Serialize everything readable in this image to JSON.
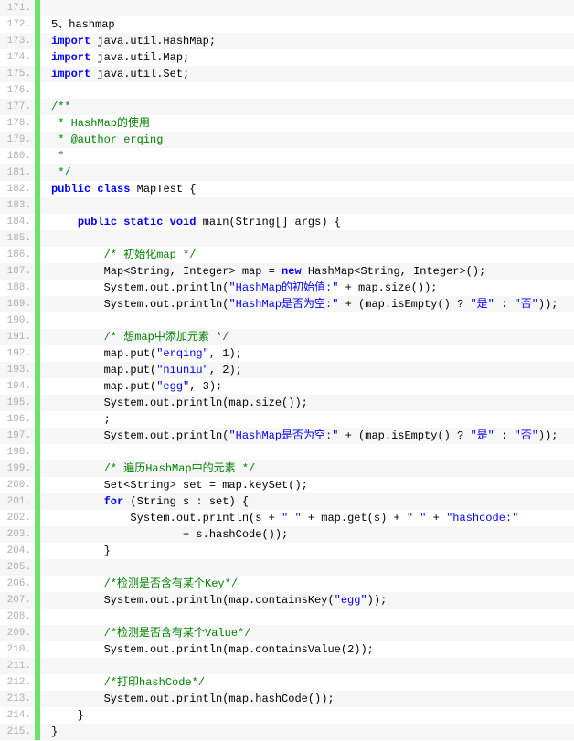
{
  "lines": [
    {
      "num": "171.",
      "spans": [
        {
          "c": "pl",
          "t": " "
        }
      ]
    },
    {
      "num": "172.",
      "spans": [
        {
          "c": "pl",
          "t": "5、hashmap"
        }
      ]
    },
    {
      "num": "173.",
      "spans": [
        {
          "c": "kw",
          "t": "import"
        },
        {
          "c": "pl",
          "t": " java.util.HashMap;"
        }
      ]
    },
    {
      "num": "174.",
      "spans": [
        {
          "c": "kw",
          "t": "import"
        },
        {
          "c": "pl",
          "t": " java.util.Map;"
        }
      ]
    },
    {
      "num": "175.",
      "spans": [
        {
          "c": "kw",
          "t": "import"
        },
        {
          "c": "pl",
          "t": " java.util.Set;"
        }
      ]
    },
    {
      "num": "176.",
      "spans": [
        {
          "c": "pl",
          "t": " "
        }
      ]
    },
    {
      "num": "177.",
      "spans": [
        {
          "c": "cm",
          "t": "/**"
        }
      ]
    },
    {
      "num": "178.",
      "spans": [
        {
          "c": "cm",
          "t": " * HashMap的使用"
        }
      ]
    },
    {
      "num": "179.",
      "spans": [
        {
          "c": "cm",
          "t": " * @author erqing"
        }
      ]
    },
    {
      "num": "180.",
      "spans": [
        {
          "c": "cm",
          "t": " * "
        }
      ]
    },
    {
      "num": "181.",
      "spans": [
        {
          "c": "cm",
          "t": " */"
        }
      ]
    },
    {
      "num": "182.",
      "spans": [
        {
          "c": "kw",
          "t": "public"
        },
        {
          "c": "pl",
          "t": " "
        },
        {
          "c": "kw",
          "t": "class"
        },
        {
          "c": "pl",
          "t": " MapTest {"
        }
      ]
    },
    {
      "num": "183.",
      "spans": [
        {
          "c": "pl",
          "t": " "
        }
      ]
    },
    {
      "num": "184.",
      "spans": [
        {
          "c": "pl",
          "t": "    "
        },
        {
          "c": "kw",
          "t": "public"
        },
        {
          "c": "pl",
          "t": " "
        },
        {
          "c": "kw",
          "t": "static"
        },
        {
          "c": "pl",
          "t": " "
        },
        {
          "c": "kw",
          "t": "void"
        },
        {
          "c": "pl",
          "t": " main(String[] args) {"
        }
      ]
    },
    {
      "num": "185.",
      "spans": [
        {
          "c": "pl",
          "t": " "
        }
      ]
    },
    {
      "num": "186.",
      "spans": [
        {
          "c": "pl",
          "t": "        "
        },
        {
          "c": "cm",
          "t": "/* 初始化map */"
        }
      ]
    },
    {
      "num": "187.",
      "spans": [
        {
          "c": "pl",
          "t": "        Map<String, Integer> map = "
        },
        {
          "c": "kw",
          "t": "new"
        },
        {
          "c": "pl",
          "t": " HashMap<String, Integer>();"
        }
      ]
    },
    {
      "num": "188.",
      "spans": [
        {
          "c": "pl",
          "t": "        System.out.println("
        },
        {
          "c": "str",
          "t": "\"HashMap的初始值:\""
        },
        {
          "c": "pl",
          "t": " + map.size());"
        }
      ]
    },
    {
      "num": "189.",
      "spans": [
        {
          "c": "pl",
          "t": "        System.out.println("
        },
        {
          "c": "str",
          "t": "\"HashMap是否为空:\""
        },
        {
          "c": "pl",
          "t": " + (map.isEmpty() ? "
        },
        {
          "c": "str",
          "t": "\"是\""
        },
        {
          "c": "pl",
          "t": " : "
        },
        {
          "c": "str",
          "t": "\"否\""
        },
        {
          "c": "pl",
          "t": "));"
        }
      ]
    },
    {
      "num": "190.",
      "spans": [
        {
          "c": "pl",
          "t": " "
        }
      ]
    },
    {
      "num": "191.",
      "spans": [
        {
          "c": "pl",
          "t": "        "
        },
        {
          "c": "cm",
          "t": "/* 想map中添加元素 */"
        }
      ]
    },
    {
      "num": "192.",
      "spans": [
        {
          "c": "pl",
          "t": "        map.put("
        },
        {
          "c": "str",
          "t": "\"erqing\""
        },
        {
          "c": "pl",
          "t": ", "
        },
        {
          "c": "num",
          "t": "1"
        },
        {
          "c": "pl",
          "t": ");"
        }
      ]
    },
    {
      "num": "193.",
      "spans": [
        {
          "c": "pl",
          "t": "        map.put("
        },
        {
          "c": "str",
          "t": "\"niuniu\""
        },
        {
          "c": "pl",
          "t": ", "
        },
        {
          "c": "num",
          "t": "2"
        },
        {
          "c": "pl",
          "t": ");"
        }
      ]
    },
    {
      "num": "194.",
      "spans": [
        {
          "c": "pl",
          "t": "        map.put("
        },
        {
          "c": "str",
          "t": "\"egg\""
        },
        {
          "c": "pl",
          "t": ", "
        },
        {
          "c": "num",
          "t": "3"
        },
        {
          "c": "pl",
          "t": ");"
        }
      ]
    },
    {
      "num": "195.",
      "spans": [
        {
          "c": "pl",
          "t": "        System.out.println(map.size());"
        }
      ]
    },
    {
      "num": "196.",
      "spans": [
        {
          "c": "pl",
          "t": "        ;"
        }
      ]
    },
    {
      "num": "197.",
      "spans": [
        {
          "c": "pl",
          "t": "        System.out.println("
        },
        {
          "c": "str",
          "t": "\"HashMap是否为空:\""
        },
        {
          "c": "pl",
          "t": " + (map.isEmpty() ? "
        },
        {
          "c": "str",
          "t": "\"是\""
        },
        {
          "c": "pl",
          "t": " : "
        },
        {
          "c": "str",
          "t": "\"否\""
        },
        {
          "c": "pl",
          "t": "));"
        }
      ]
    },
    {
      "num": "198.",
      "spans": [
        {
          "c": "pl",
          "t": " "
        }
      ]
    },
    {
      "num": "199.",
      "spans": [
        {
          "c": "pl",
          "t": "        "
        },
        {
          "c": "cm",
          "t": "/* 遍历HashMap中的元素 */"
        }
      ]
    },
    {
      "num": "200.",
      "spans": [
        {
          "c": "pl",
          "t": "        Set<String> set = map.keySet();"
        }
      ]
    },
    {
      "num": "201.",
      "spans": [
        {
          "c": "pl",
          "t": "        "
        },
        {
          "c": "kw",
          "t": "for"
        },
        {
          "c": "pl",
          "t": " (String s : set) {"
        }
      ]
    },
    {
      "num": "202.",
      "spans": [
        {
          "c": "pl",
          "t": "            System.out.println(s + "
        },
        {
          "c": "str",
          "t": "\" \""
        },
        {
          "c": "pl",
          "t": " + map.get(s) + "
        },
        {
          "c": "str",
          "t": "\" \""
        },
        {
          "c": "pl",
          "t": " + "
        },
        {
          "c": "str",
          "t": "\"hashcode:\""
        }
      ]
    },
    {
      "num": "203.",
      "spans": [
        {
          "c": "pl",
          "t": "                    + s.hashCode());"
        }
      ]
    },
    {
      "num": "204.",
      "spans": [
        {
          "c": "pl",
          "t": "        }"
        }
      ]
    },
    {
      "num": "205.",
      "spans": [
        {
          "c": "pl",
          "t": " "
        }
      ]
    },
    {
      "num": "206.",
      "spans": [
        {
          "c": "pl",
          "t": "        "
        },
        {
          "c": "cm",
          "t": "/*检测是否含有某个Key*/"
        }
      ]
    },
    {
      "num": "207.",
      "spans": [
        {
          "c": "pl",
          "t": "        System.out.println(map.containsKey("
        },
        {
          "c": "str",
          "t": "\"egg\""
        },
        {
          "c": "pl",
          "t": "));"
        }
      ]
    },
    {
      "num": "208.",
      "spans": [
        {
          "c": "pl",
          "t": " "
        }
      ]
    },
    {
      "num": "209.",
      "spans": [
        {
          "c": "pl",
          "t": "        "
        },
        {
          "c": "cm",
          "t": "/*检测是否含有某个Value*/"
        }
      ]
    },
    {
      "num": "210.",
      "spans": [
        {
          "c": "pl",
          "t": "        System.out.println(map.containsValue("
        },
        {
          "c": "num",
          "t": "2"
        },
        {
          "c": "pl",
          "t": "));"
        }
      ]
    },
    {
      "num": "211.",
      "spans": [
        {
          "c": "pl",
          "t": " "
        }
      ]
    },
    {
      "num": "212.",
      "spans": [
        {
          "c": "pl",
          "t": "        "
        },
        {
          "c": "cm",
          "t": "/*打印hashCode*/"
        }
      ]
    },
    {
      "num": "213.",
      "spans": [
        {
          "c": "pl",
          "t": "        System.out.println(map.hashCode());"
        }
      ]
    },
    {
      "num": "214.",
      "spans": [
        {
          "c": "pl",
          "t": "    }"
        }
      ]
    },
    {
      "num": "215.",
      "spans": [
        {
          "c": "pl",
          "t": "}"
        }
      ]
    }
  ]
}
